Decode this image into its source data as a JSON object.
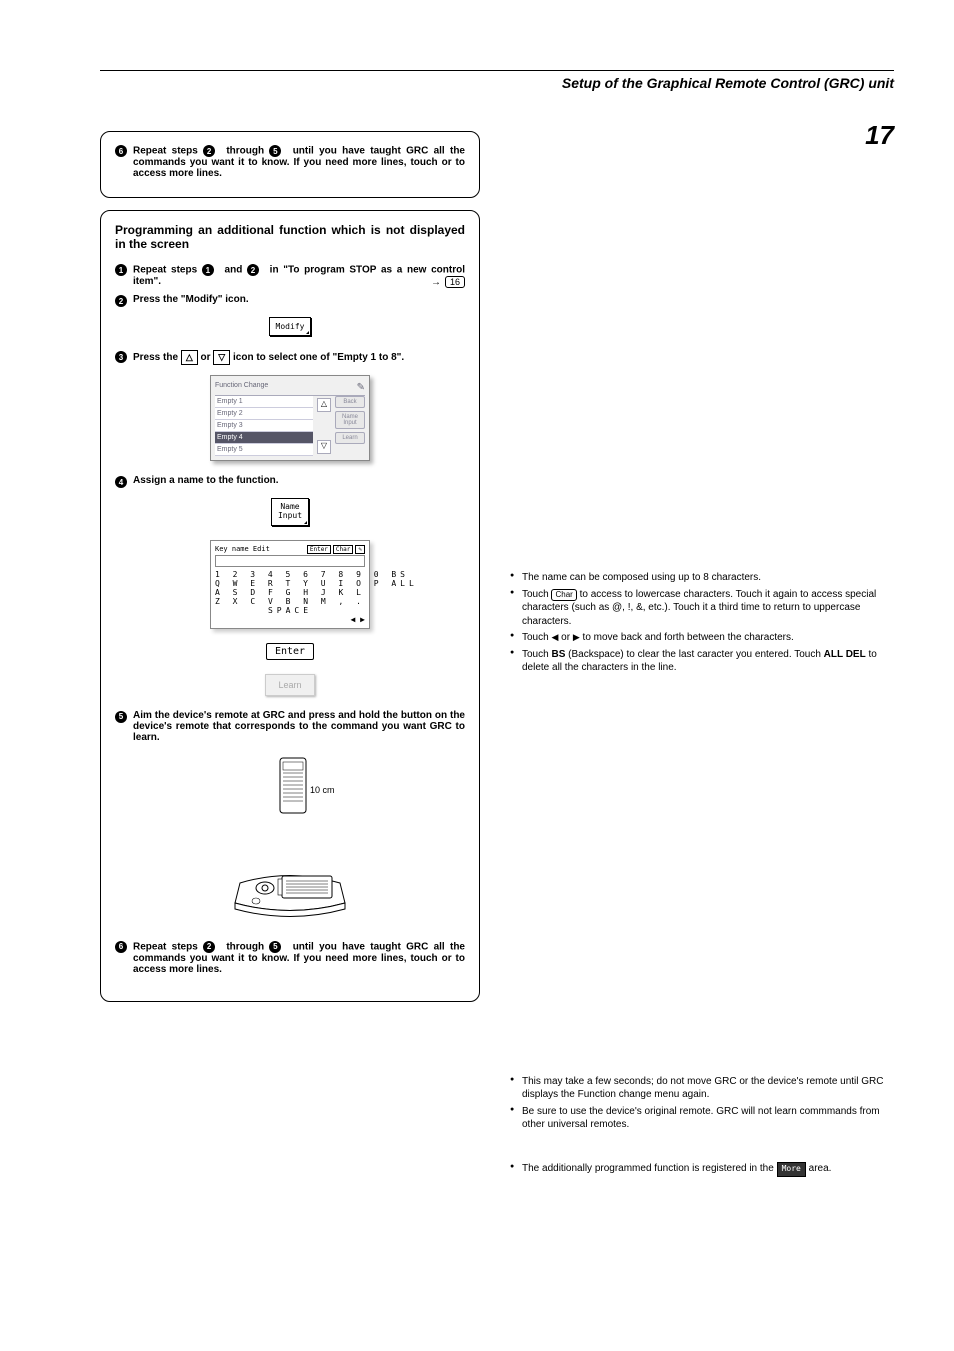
{
  "header": {
    "section_title": "Setup of the Graphical Remote Control (GRC) unit",
    "page_number": "17"
  },
  "box1": {
    "step6_num": "6",
    "step6_a": "2",
    "step6_b": "5",
    "step6_text_prefix": "Repeat steps ",
    "step6_text_mid": " through ",
    "step6_text_suffix": " until you have taught GRC all the commands you want it to know.  If you need more lines, touch or  to access more lines."
  },
  "box2": {
    "heading": "Programming an additional function which is not displayed in the screen",
    "step1_num": "1",
    "step1_a": "1",
    "step1_b": "2",
    "step1_text_prefix": "Repeat steps ",
    "step1_text_mid": " and ",
    "step1_text_suffix": " in \"To program STOP as a new control item\".",
    "step1_ref": "16",
    "step2_num": "2",
    "step2_text": "Press the \"Modify\" icon.",
    "modify_btn": "Modify",
    "step3_num": "3",
    "step3_text_prefix": "Press the ",
    "step3_text_mid": " or ",
    "step3_text_suffix": " icon to select one of \"Empty 1 to 8\".",
    "panel": {
      "title": "Function Change",
      "rows": [
        "Empty 1",
        "Empty 2",
        "Empty 3",
        "Empty 4",
        "Empty 5"
      ],
      "side": [
        "Back",
        "Name Input",
        "Learn"
      ]
    },
    "step4_num": "4",
    "step4_text": "Assign a name to the function.",
    "name_input_btn": "Name\nInput",
    "keyboard": {
      "header_left": "Key name Edit",
      "header_enter": "Enter",
      "header_char": "Char",
      "row1": "1 2 3 4 5 6 7 8 9 0 BS",
      "row2": "Q W E R T Y U I O P ALL",
      "row3": "A S D F G H J K L",
      "row4": "Z X C V B N M , .",
      "row5": "SPACE"
    },
    "enter_btn": "Enter",
    "learn_btn": "Learn",
    "step5_num": "5",
    "step5_text": "Aim the device's remote at GRC and press and hold the button on the device's remote that corresponds to the command you want GRC to learn.",
    "distance": "10 cm",
    "step6_num": "6",
    "step6_a": "2",
    "step6_b": "5",
    "step6_text_prefix": "Repeat steps ",
    "step6_text_mid": " through ",
    "step6_text_suffix": " until you have taught GRC all the commands you want it to know.  If you need more lines, touch or  to access more lines."
  },
  "notes_a": {
    "n1": "The name can be composed using up to 8 characters.",
    "n2_prefix": "Touch ",
    "n2_char": "Char",
    "n2_mid": " to access to lowercase characters.  Touch it again to access special characters (such as @, !, &, etc.). Touch it a third time to return to uppercase characters.",
    "n3_prefix": "Touch ",
    "n3_mid": " or ",
    "n3_suffix": " to move back and forth between the characters.",
    "n4_prefix": "Touch ",
    "n4_bs": "BS",
    "n4_mid": " (Backspace) to clear the last caracter you entered.  Touch ",
    "n4_alldel": "ALL DEL",
    "n4_suffix": " to delete all the characters in the line."
  },
  "notes_b": {
    "n1": "This may take a few seconds; do not move GRC or the device's remote until GRC displays the Function change menu again.",
    "n2": "Be sure to use the device's original remote.  GRC will not learn commmands from other universal remotes.",
    "n3_prefix": "The additionally programmed function is registered in the ",
    "n3_more": "More",
    "n3_suffix": " area."
  }
}
